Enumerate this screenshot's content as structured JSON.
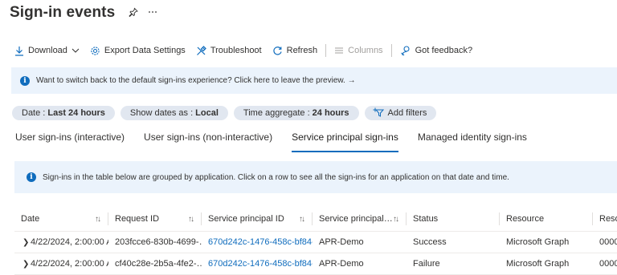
{
  "page": {
    "title": "Sign-in events"
  },
  "toolbar": {
    "download": "Download",
    "export": "Export Data Settings",
    "troubleshoot": "Troubleshoot",
    "refresh": "Refresh",
    "columns": "Columns",
    "feedback": "Got feedback?"
  },
  "preview_banner": {
    "text": "Want to switch back to the default sign-ins experience? Click here to leave the preview. →"
  },
  "filters": {
    "date_label": "Date :",
    "date_value": "Last 24 hours",
    "show_dates_label": "Show dates as :",
    "show_dates_value": "Local",
    "aggregate_label": "Time aggregate :",
    "aggregate_value": "24 hours",
    "add_filters": "Add filters"
  },
  "tabs": [
    {
      "label": "User sign-ins (interactive)"
    },
    {
      "label": "User sign-ins (non-interactive)"
    },
    {
      "label": "Service principal sign-ins"
    },
    {
      "label": "Managed identity sign-ins"
    }
  ],
  "info_banner": {
    "text": "Sign-ins in the table below are grouped by application. Click on a row to see all the sign-ins for an application on that date and time."
  },
  "grid": {
    "headers": [
      "Date",
      "Request ID",
      "Service principal ID",
      "Service principal…",
      "Status",
      "Resource",
      "Reso"
    ],
    "rows": [
      {
        "date": "4/22/2024, 2:00:00 A",
        "request_id": "203fcce6-830b-4699-…",
        "sp_id": "670d242c-1476-458c-bf84-",
        "sp_name": "APR-Demo",
        "status": "Success",
        "resource": "Microsoft Graph",
        "resource_id": "00000"
      },
      {
        "date": "4/22/2024, 2:00:00 A",
        "request_id": "cf40c28e-2b5a-4fe2-…",
        "sp_id": "670d242c-1476-458c-bf84-",
        "sp_name": "APR-Demo",
        "status": "Failure",
        "resource": "Microsoft Graph",
        "resource_id": "00000"
      }
    ]
  },
  "colors": {
    "accent": "#0f6cbd",
    "banner_bg": "#ebf3fc",
    "pill_bg": "#e1e7f0"
  }
}
